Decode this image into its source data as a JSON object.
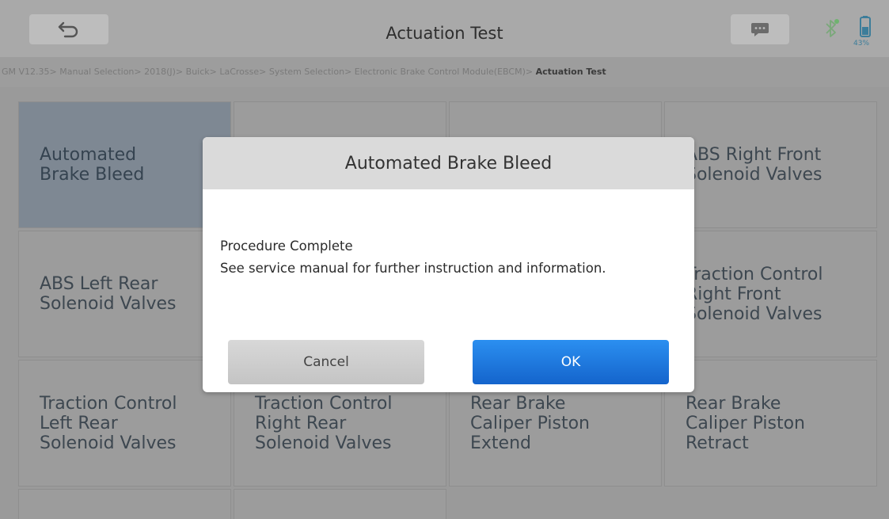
{
  "header": {
    "title": "Actuation Test",
    "battery_percent": "43%"
  },
  "breadcrumb": {
    "path": "GM V12.35> Manual Selection> 2018(J)> Buick> LaCrosse> System Selection> Electronic Brake Control Module(EBCM)> ",
    "current": "Actuation Test"
  },
  "tiles": [
    {
      "line1": "Automated",
      "line2": "Brake Bleed",
      "line3": ""
    },
    {
      "line1": "ABS Right Front",
      "line2": "Solenoid Valves",
      "line3": ""
    },
    {
      "line1": "ABS Left Rear",
      "line2": "Solenoid Valves",
      "line3": ""
    },
    {
      "line1": "Traction Control",
      "line2": "Right Front",
      "line3": "Solenoid Valves"
    },
    {
      "line1": "Traction Control",
      "line2": "Left Rear",
      "line3": "Solenoid Valves"
    },
    {
      "line1": "Traction Control",
      "line2": "Right Rear",
      "line3": "Solenoid Valves"
    },
    {
      "line1": "Rear Brake",
      "line2": "Caliper Piston",
      "line3": "Extend"
    },
    {
      "line1": "Rear Brake",
      "line2": "Caliper Piston",
      "line3": "Retract"
    }
  ],
  "dialog": {
    "title": "Automated Brake Bleed",
    "message_line1": "Procedure Complete",
    "message_line2": "See service manual for further instruction and information.",
    "cancel_label": "Cancel",
    "ok_label": "OK"
  },
  "colors": {
    "ok_button": "#1a73d9",
    "selected_tile": "#7e8893",
    "dim_background": "#9a9a9a"
  }
}
